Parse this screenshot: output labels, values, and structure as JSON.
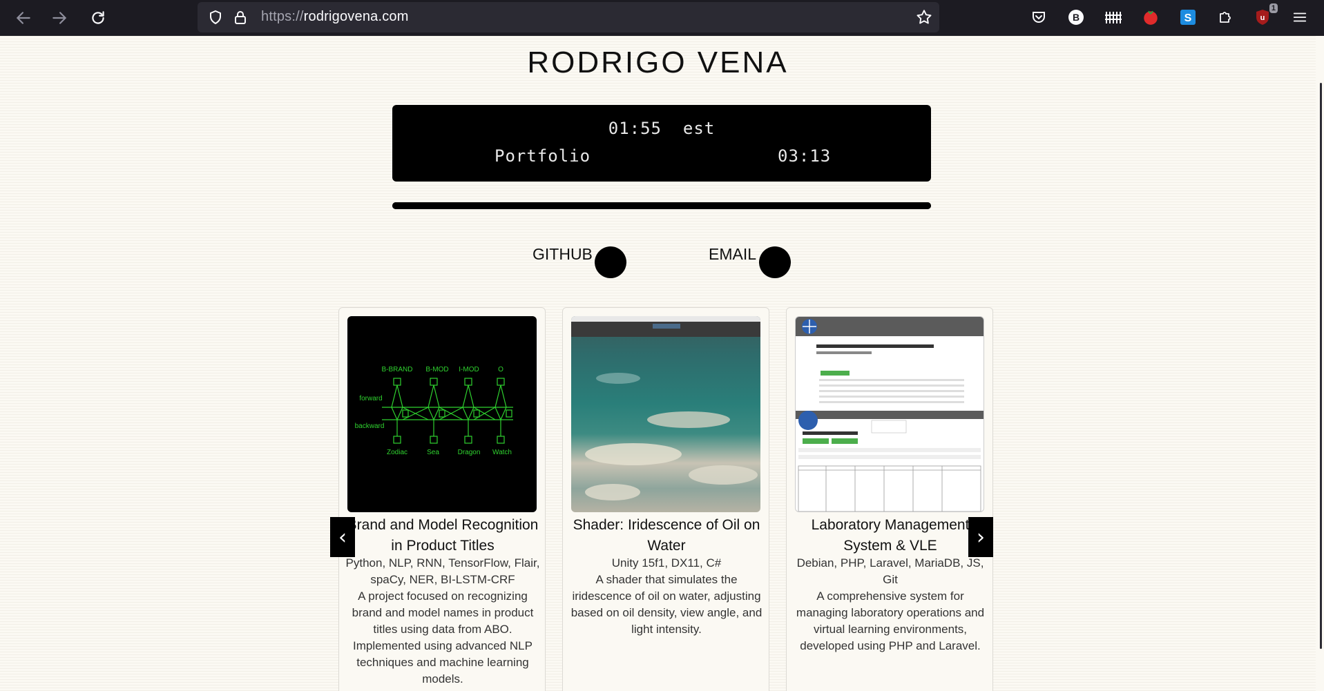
{
  "browser": {
    "url_protocol": "https://",
    "url_host": "rodrigovena.com",
    "extension_badge": "1"
  },
  "site": {
    "title": "RODRIGO VENA"
  },
  "player": {
    "time_tz": "01:55  est",
    "track": "Portfolio",
    "elapsed": "03:13",
    "progress": 1.0
  },
  "social": {
    "github": "GITHUB",
    "email": "EMAIL"
  },
  "carousel": {
    "prev": "‹",
    "next": "›",
    "cards": [
      {
        "title": "Brand and Model Recognition in Product Titles",
        "tech": "Python, NLP, RNN, TensorFlow, Flair, spaCy, NER, BI-LSTM-CRF",
        "desc": "A project focused on recognizing brand and model names in product titles using data from ABO. Implemented using advanced NLP techniques and machine learning models.",
        "diagram_top": [
          "B-BRAND",
          "B-MOD",
          "I-MOD",
          "O"
        ],
        "diagram_bottom": [
          "Zodiac",
          "Sea",
          "Dragon",
          "Watch"
        ],
        "diagram_forward": "forward",
        "diagram_backward": "backward"
      },
      {
        "title": "Shader: Iridescence of Oil on Water",
        "tech": "Unity 15f1, DX11, C#",
        "desc": "A shader that simulates the iridescence of oil on water, adjusting based on oil density, view angle, and light intensity."
      },
      {
        "title": "Laboratory Management System & VLE",
        "tech": "Debian, PHP, Laravel, MariaDB, JS, Git",
        "desc": "A comprehensive system for managing laboratory operations and virtual learning environments, developed using PHP and Laravel."
      }
    ]
  }
}
